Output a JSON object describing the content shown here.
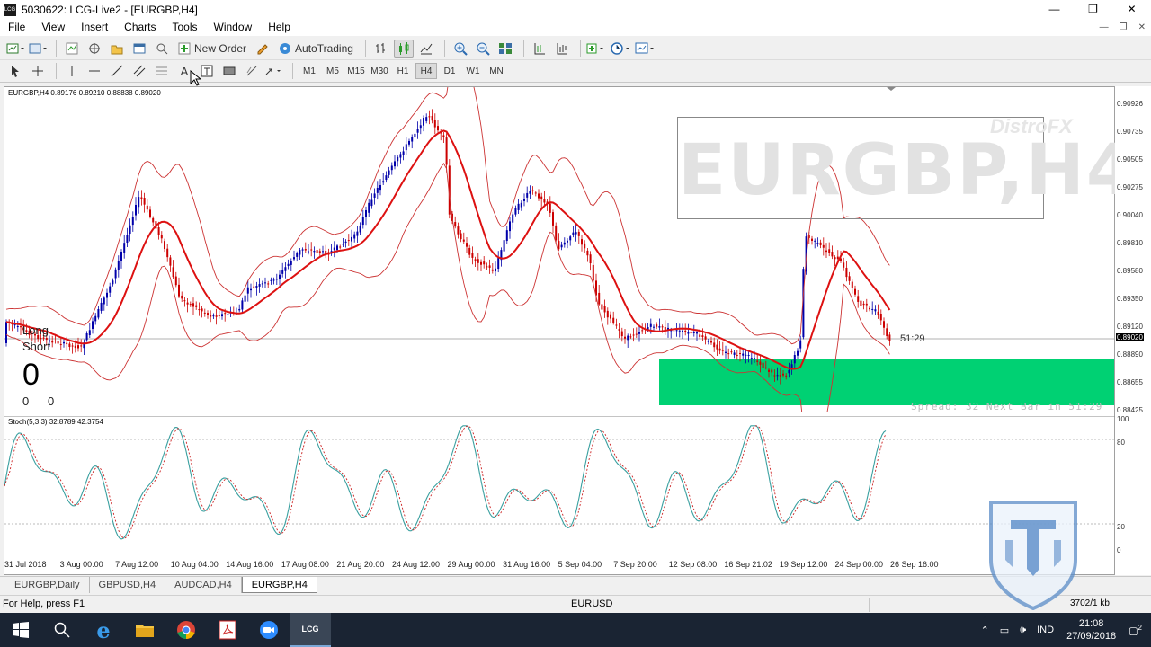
{
  "window": {
    "title": "5030622: LCG-Live2 - [EURGBP,H4]",
    "app_icon": "LCG",
    "minimize": "—",
    "restore": "❐",
    "close": "✕"
  },
  "menu": [
    "File",
    "View",
    "Insert",
    "Charts",
    "Tools",
    "Window",
    "Help"
  ],
  "toolbar": {
    "new_order": "New Order",
    "auto_trading": "AutoTrading"
  },
  "timeframes": [
    "M1",
    "M5",
    "M15",
    "M30",
    "H1",
    "H4",
    "D1",
    "W1",
    "MN"
  ],
  "active_timeframe": "H4",
  "chart": {
    "header": "EURGBP,H4  0.89176 0.89210 0.88838 0.89020",
    "symbol_watermark": "EURGBP,H4",
    "brand_watermark": "DistroFX",
    "countdown": "51:29",
    "spread_info": "Spread: 32  Next Bar in 51:29",
    "current_price": "0.89020",
    "colors": {
      "bull": "#0000aa",
      "bear": "#cc0000",
      "ma": "#dd1111",
      "band": "#cc3333",
      "zone": "#00d173"
    }
  },
  "price_axis": [
    "0.90926",
    "0.90735",
    "0.90505",
    "0.90275",
    "0.90040",
    "0.89810",
    "0.89580",
    "0.89350",
    "0.89120",
    "0.88890",
    "0.88655",
    "0.88425"
  ],
  "position_panel": {
    "long": "Long",
    "short": "Short",
    "count": "0",
    "value_a": "0",
    "value_b": "0"
  },
  "stochastic": {
    "header": "Stoch(5,3,3) 32.8789 42.3754",
    "levels": [
      "100",
      "80",
      "20",
      "0"
    ],
    "colors": {
      "main": "#3aa0a0",
      "signal": "#cc2222"
    }
  },
  "time_axis": [
    "31 Jul 2018",
    "3 Aug 00:00",
    "7 Aug 12:00",
    "10 Aug 04:00",
    "14 Aug 16:00",
    "17 Aug 08:00",
    "21 Aug 20:00",
    "24 Aug 12:00",
    "29 Aug 00:00",
    "31 Aug 16:00",
    "5 Sep 04:00",
    "7 Sep 20:00",
    "12 Sep 08:00",
    "16 Sep 21:02",
    "19 Sep 12:00",
    "24 Sep 00:00",
    "26 Sep 16:00"
  ],
  "tabs": [
    "EURGBP,Daily",
    "GBPUSD,H4",
    "AUDCAD,H4",
    "EURGBP,H4"
  ],
  "active_tab": "EURGBP,H4",
  "status": {
    "help": "For Help, press F1",
    "symbol": "EURUSD",
    "traffic": "3702/1 kb"
  },
  "taskbar": {
    "items": [
      "windows-start",
      "search",
      "edge",
      "file-explorer",
      "chrome",
      "acrobat",
      "zoom",
      "lcg-terminal"
    ],
    "lang": "IND",
    "time": "21:08",
    "date": "27/09/2018",
    "notifications": "2"
  }
}
